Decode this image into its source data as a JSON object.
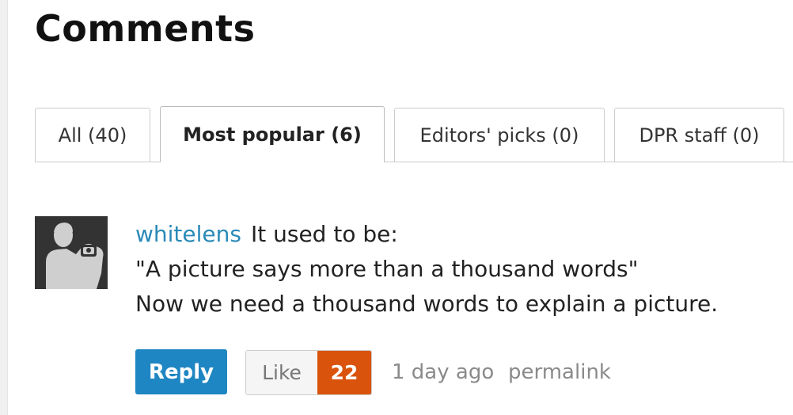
{
  "header": {
    "title": "Comments"
  },
  "tabs": [
    {
      "label": "All (40)",
      "active": false
    },
    {
      "label": "Most popular (6)",
      "active": true
    },
    {
      "label": "Editors' picks (0)",
      "active": false
    },
    {
      "label": "DPR staff (0)",
      "active": false
    }
  ],
  "comment": {
    "author": "whitelens",
    "avatar_icon": "user-silhouette-photographer-icon",
    "lines": [
      "It used to be:",
      "\"A picture says more than a thousand words\"",
      "Now we need a thousand words to explain a picture."
    ],
    "reply_label": "Reply",
    "like_label": "Like",
    "like_count": "22",
    "timestamp": "1 day ago",
    "permalink_label": "permalink"
  },
  "colors": {
    "link": "#2a8ab8",
    "reply_button": "#1e86c2",
    "like_count_bg": "#d9530d"
  }
}
